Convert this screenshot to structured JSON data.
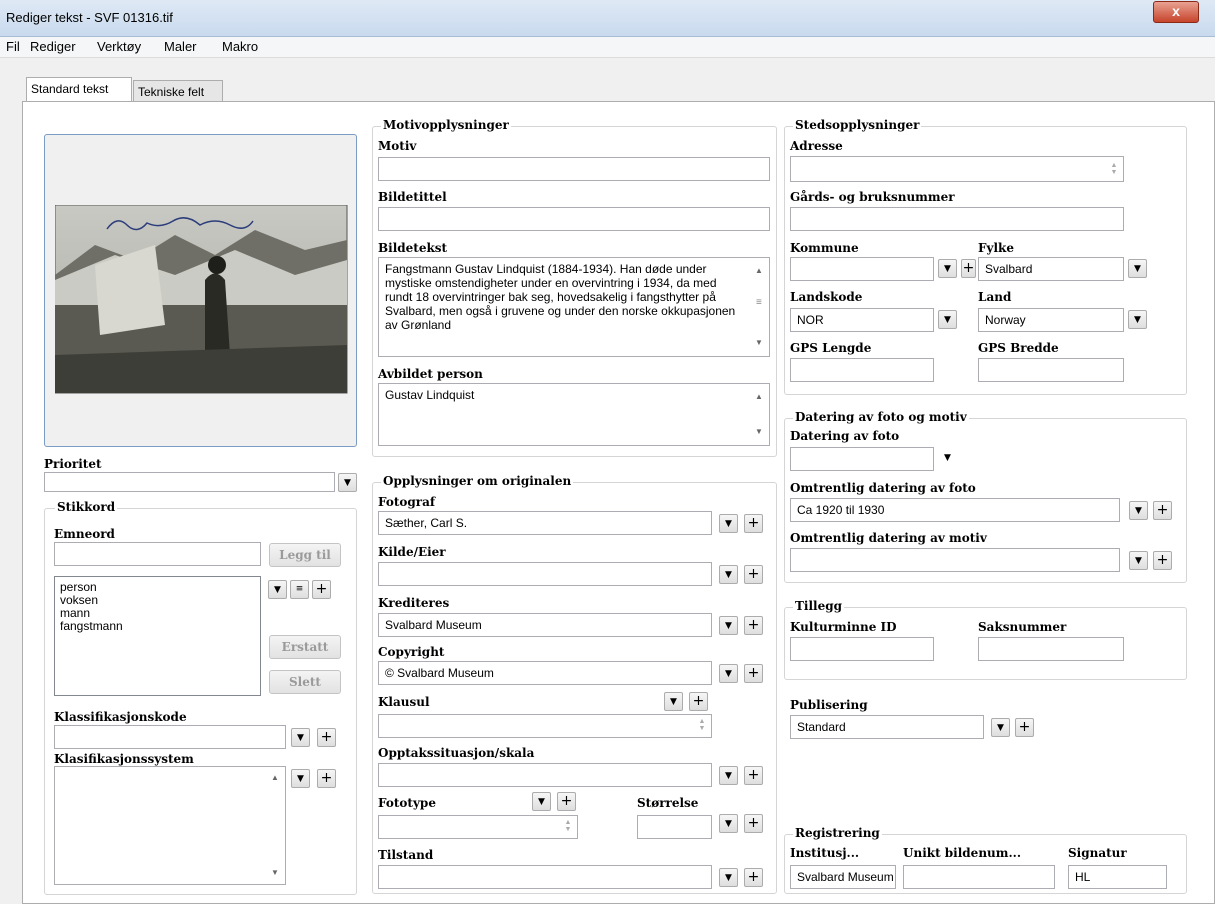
{
  "window": {
    "title": "Rediger tekst - SVF 01316.tif",
    "close": "x"
  },
  "menu": [
    "Fil",
    "Rediger",
    "Verktøy",
    "Maler",
    "Makro"
  ],
  "tabs": [
    "Standard tekst",
    "Tekniske felt"
  ],
  "photo": {
    "caption": "Gustav Lindqvist"
  },
  "left": {
    "prioritet_label": "Prioritet",
    "prioritet_value": "",
    "stikkord_title": "Stikkord",
    "emneord_label": "Emneord",
    "emneord_value": "",
    "legg_til": "Legg til",
    "keywords": [
      "person",
      "voksen",
      "mann",
      "fangstmann"
    ],
    "erstatt": "Erstatt",
    "slett": "Slett",
    "klass_label": "Klassifikasjonskode",
    "klassys_label": "Klasifikasjonssystem"
  },
  "motiv": {
    "title": "Motivopplysninger",
    "motiv_label": "Motiv",
    "bildetittel_label": "Bildetittel",
    "bildetekst_label": "Bildetekst",
    "bildetekst_value": "Fangstmann Gustav Lindquist (1884-1934). Han døde under mystiske omstendigheter under en overvintring i 1934, da med rundt 18 overvintringer bak seg, hovedsakelig i fangsthytter på Svalbard, men også i gruvene og under den norske okkupasjonen av Grønland",
    "avbildet_label": "Avbildet person",
    "avbildet_value": "Gustav Lindquist"
  },
  "orig": {
    "title": "Opplysninger om originalen",
    "fotograf_label": "Fotograf",
    "fotograf_value": "Sæther, Carl S.",
    "kilde_label": "Kilde/Eier",
    "kred_label": "Krediteres",
    "kred_value": "Svalbard Museum",
    "copy_label": "Copyright",
    "copy_value": "© Svalbard Museum",
    "klausul_label": "Klausul",
    "opptak_label": "Opptakssituasjon/skala",
    "fototype_label": "Fototype",
    "storrelse_label": "Størrelse",
    "tilstand_label": "Tilstand"
  },
  "sted": {
    "title": "Stedsopplysninger",
    "adresse_label": "Adresse",
    "gards_label": "Gårds- og bruksnummer",
    "kommune_label": "Kommune",
    "fylke_label": "Fylke",
    "fylke_value": "Svalbard",
    "landskode_label": "Landskode",
    "landskode_value": "NOR",
    "land_label": "Land",
    "land_value": "Norway",
    "gps_lengde_label": "GPS Lengde",
    "gps_bredde_label": "GPS Bredde"
  },
  "datering": {
    "title": "Datering av foto og motiv",
    "foto_label": "Datering av foto",
    "omtr_foto_label": "Omtrentlig datering av foto",
    "omtr_foto_value": "Ca 1920 til 1930",
    "omtr_motiv_label": "Omtrentlig datering av motiv"
  },
  "tillegg": {
    "title": "Tillegg",
    "kultur_label": "Kulturminne ID",
    "saks_label": "Saksnummer"
  },
  "publisering": {
    "label": "Publisering",
    "value": "Standard"
  },
  "registrering": {
    "title": "Registrering",
    "inst_label": "Institusj...",
    "inst_value": "Svalbard Museum",
    "unikt_label": "Unikt bildenum...",
    "sign_label": "Signatur",
    "sign_value": "HL"
  },
  "colors": {
    "title_gradient_top": "#dfe9f5",
    "close_red": "#c7442b",
    "panel_bg": "#ffffff"
  }
}
